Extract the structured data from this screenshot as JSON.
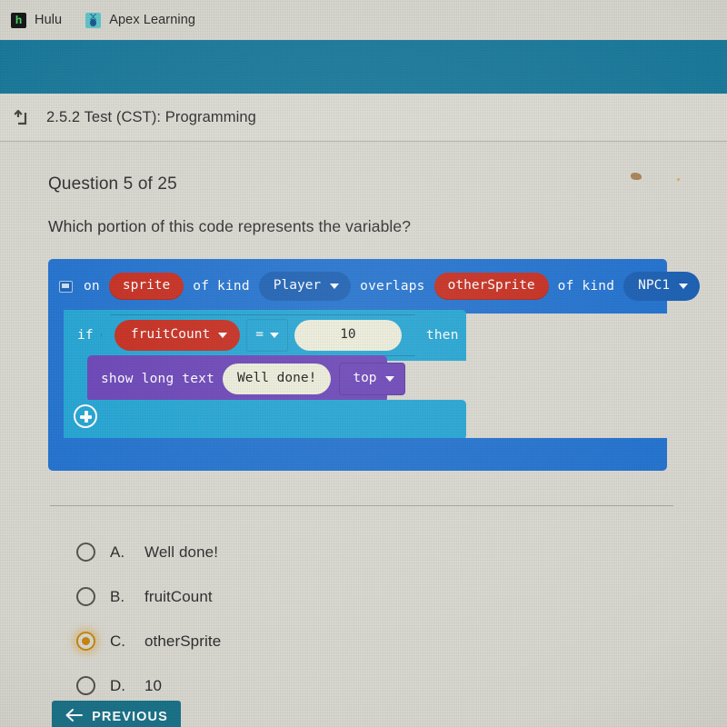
{
  "browser": {
    "bookmarks": [
      {
        "label": "Hulu",
        "icon": "hulu-favicon"
      },
      {
        "label": "Apex Learning",
        "icon": "apex-learning-favicon"
      }
    ]
  },
  "banner": {
    "color": "#1b7a9c"
  },
  "header": {
    "back_icon": "return-up-left-arrow-icon",
    "title": "2.5.2  Test (CST):  Programming"
  },
  "question": {
    "number_label": "Question 5 of 25",
    "prompt": "Which portion of this code represents the variable?"
  },
  "code": {
    "event_block": {
      "icon": "screen-icon",
      "word_on": "on",
      "sprite_var": "sprite",
      "of_kind_1": "of kind",
      "kind_1": "Player",
      "overlaps": "overlaps",
      "other_sprite_var": "otherSprite",
      "of_kind_2": "of kind",
      "kind_2": "NPC1"
    },
    "if_block": {
      "word_if": "if",
      "variable": "fruitCount",
      "operator": "=",
      "value": "10",
      "word_then": "then",
      "add_icon": "plus-circle-icon"
    },
    "show_block": {
      "label": "show long text",
      "text_value": "Well done!",
      "position": "top"
    },
    "colors": {
      "event": "#2172d0",
      "logic": "#22a5d4",
      "variable": "#c72c1e",
      "console": "#6b44b8",
      "field": "#eeeedc"
    }
  },
  "options": [
    {
      "letter": "A.",
      "text": "Well done!",
      "selected": false
    },
    {
      "letter": "B.",
      "text": "fruitCount",
      "selected": false
    },
    {
      "letter": "C.",
      "text": "otherSprite",
      "selected": true
    },
    {
      "letter": "D.",
      "text": "10",
      "selected": false
    }
  ],
  "footer": {
    "previous_label": "PREVIOUS",
    "previous_icon": "arrow-left-icon",
    "previous_color": "#1b7389"
  }
}
